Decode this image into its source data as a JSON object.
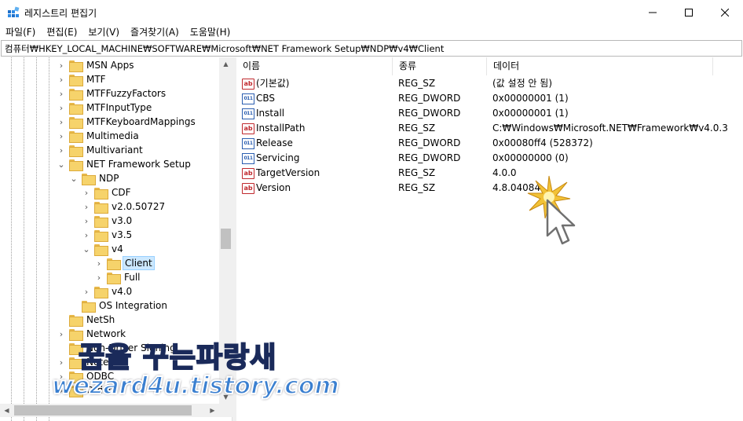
{
  "window": {
    "title": "레지스트리 편집기",
    "controls": {
      "minimize": "minimize-icon",
      "maximize": "maximize-icon",
      "close": "close-icon"
    }
  },
  "menu": [
    "파일(F)",
    "편집(E)",
    "보기(V)",
    "즐겨찾기(A)",
    "도움말(H)"
  ],
  "address": "컴퓨터₩HKEY_LOCAL_MACHINE₩SOFTWARE₩Microsoft₩NET Framework Setup₩NDP₩v4₩Client",
  "tree": [
    {
      "label": "MSN Apps",
      "chevron": "›"
    },
    {
      "label": "MTF",
      "chevron": "›"
    },
    {
      "label": "MTFFuzzyFactors",
      "chevron": "›"
    },
    {
      "label": "MTFInputType",
      "chevron": "›"
    },
    {
      "label": "MTFKeyboardMappings",
      "chevron": "›"
    },
    {
      "label": "Multimedia",
      "chevron": "›"
    },
    {
      "label": "Multivariant",
      "chevron": "›"
    },
    {
      "label": "NET Framework Setup",
      "chevron": "⌄"
    },
    {
      "label": "NDP",
      "chevron": "⌄"
    },
    {
      "label": "CDF",
      "chevron": "›"
    },
    {
      "label": "v2.0.50727",
      "chevron": "›"
    },
    {
      "label": "v3.0",
      "chevron": "›"
    },
    {
      "label": "v3.5",
      "chevron": "›"
    },
    {
      "label": "v4",
      "chevron": "⌄"
    },
    {
      "label": "Client",
      "chevron": "›",
      "selected": true
    },
    {
      "label": "Full",
      "chevron": "›"
    },
    {
      "label": "v4.0",
      "chevron": "›"
    },
    {
      "label": "OS Integration",
      "chevron": ""
    },
    {
      "label": "NetSh",
      "chevron": ""
    },
    {
      "label": "Network",
      "chevron": "›"
    },
    {
      "label": "Non-Driver Signing",
      "chevron": ""
    },
    {
      "label": "Notepad",
      "chevron": "›"
    },
    {
      "label": "ODBC",
      "chevron": "›"
    },
    {
      "label": "Office",
      "chevron": "›"
    }
  ],
  "columns": {
    "name": "이름",
    "type": "종류",
    "data": "데이터"
  },
  "values": [
    {
      "icon": "string-value-icon",
      "name": "(기본값)",
      "type": "REG_SZ",
      "data": "(값 설정 안 됨)"
    },
    {
      "icon": "dword-value-icon",
      "name": "CBS",
      "type": "REG_DWORD",
      "data": "0x00000001 (1)"
    },
    {
      "icon": "dword-value-icon",
      "name": "Install",
      "type": "REG_DWORD",
      "data": "0x00000001 (1)"
    },
    {
      "icon": "string-value-icon",
      "name": "InstallPath",
      "type": "REG_SZ",
      "data": "C:₩Windows₩Microsoft.NET₩Framework₩v4.0.3..."
    },
    {
      "icon": "dword-value-icon",
      "name": "Release",
      "type": "REG_DWORD",
      "data": "0x00080ff4 (528372)"
    },
    {
      "icon": "dword-value-icon",
      "name": "Servicing",
      "type": "REG_DWORD",
      "data": "0x00000000 (0)"
    },
    {
      "icon": "string-value-icon",
      "name": "TargetVersion",
      "type": "REG_SZ",
      "data": "4.0.0"
    },
    {
      "icon": "string-value-icon",
      "name": "Version",
      "type": "REG_SZ",
      "data": "4.8.04084"
    }
  ],
  "icon_glyphs": {
    "string": "ab",
    "dword": "011"
  },
  "watermark": {
    "line1": "꿈을 꾸는파랑새",
    "line2": "wezard4u.tistory.com"
  },
  "colors": {
    "selection": "#cce8ff",
    "folder": "#f6d36b",
    "accent": "#3a7fd0"
  }
}
